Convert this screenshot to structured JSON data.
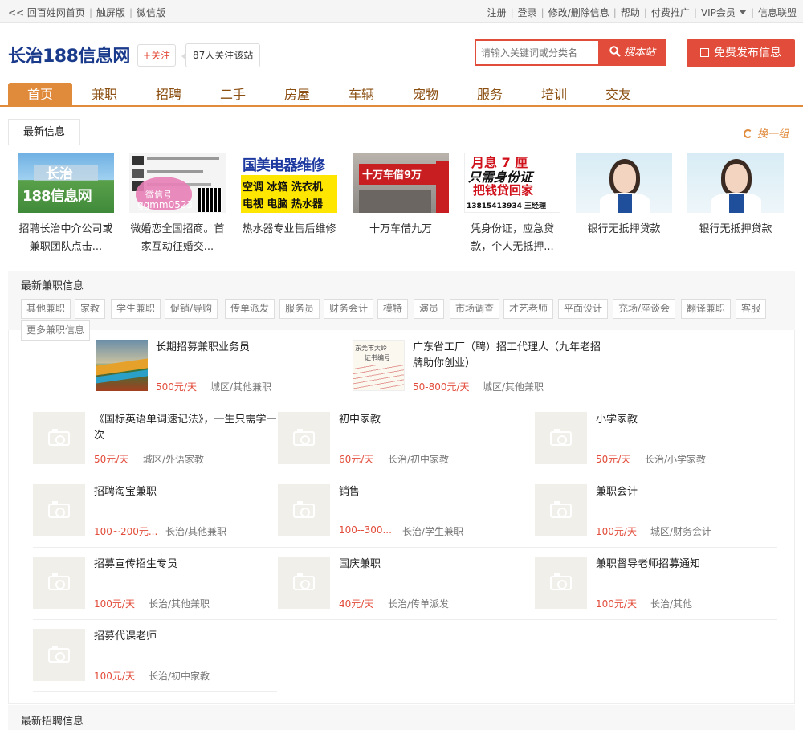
{
  "topbar": {
    "back_home": "<< 回百姓网首页",
    "touch": "触屏版",
    "wechat": "微信版",
    "register": "注册",
    "login": "登录",
    "edit_delete": "修改/删除信息",
    "help": "帮助",
    "paid_promo": "付费推广",
    "vip": "VIP会员",
    "alliance": "信息联盟"
  },
  "header": {
    "logo": "长治188信息网",
    "follow": "+关注",
    "follow_count": "87人关注该站",
    "search_placeholder": "请输入关键词或分类名",
    "search_button": "搜本站",
    "publish_button": "免费发布信息"
  },
  "nav": [
    "首页",
    "兼职",
    "招聘",
    "二手",
    "房屋",
    "车辆",
    "宠物",
    "服务",
    "培训",
    "交友"
  ],
  "latest": {
    "tab": "最新信息",
    "refresh": "换一组",
    "cards": [
      {
        "caption": "招聘长治中介公司或兼职团队点击...",
        "img_text1": "长治",
        "img_text2": "188信息网"
      },
      {
        "caption": "微婚恋全国招商。首家互动征婚交...",
        "img_text1": "微信号",
        "img_text2": "ggmm0523"
      },
      {
        "caption": "热水器专业售后维修",
        "img_text1": "国美电器维修",
        "img_text2": "空调 冰箱 洗衣机",
        "img_text3": "电视 电脑 热水器"
      },
      {
        "caption": "十万车借九万",
        "img_text1": "十万车借9万"
      },
      {
        "caption": "凭身份证，应急贷款，个人无抵押...",
        "img_text1": "月息 7 厘",
        "img_text2": "只需身份证",
        "img_text3": "把钱贷回家",
        "img_text4": "13815413934 王经理"
      },
      {
        "caption": "银行无抵押贷款"
      },
      {
        "caption": "银行无抵押贷款"
      }
    ]
  },
  "parttime": {
    "title": "最新兼职信息",
    "tags": [
      "其他兼职",
      "家教",
      "学生兼职",
      "促销/导购",
      "传单派发",
      "服务员",
      "财务会计",
      "模特",
      "演员",
      "市场调查",
      "才艺老师",
      "平面设计",
      "充场/座谈会",
      "翻译兼职",
      "客服",
      "更多兼职信息"
    ],
    "featured": [
      {
        "title": "长期招募兼职业务员",
        "price": "500元/天",
        "location": "城区/其他兼职"
      },
      {
        "title": "广东省工厂（聘）招工代理人（九年老招牌助你创业）",
        "price": "50-800元/天",
        "location": "城区/其他兼职",
        "img_text1": "东莞市大岭",
        "img_text2": "证书编号"
      }
    ],
    "listings": [
      {
        "title": "《国标英语单词速记法》，一生只需学一次",
        "price": "50元/天",
        "location": "城区/外语家教"
      },
      {
        "title": "初中家教",
        "price": "60元/天",
        "location": "长治/初中家教"
      },
      {
        "title": "小学家教",
        "price": "50元/天",
        "location": "长治/小学家教"
      },
      {
        "title": "招聘淘宝兼职",
        "price": "100~200元...",
        "location": "长治/其他兼职"
      },
      {
        "title": "销售",
        "price": "100--300...",
        "location": "长治/学生兼职"
      },
      {
        "title": "兼职会计",
        "price": "100元/天",
        "location": "城区/财务会计"
      },
      {
        "title": "招募宣传招生专员",
        "price": "100元/天",
        "location": "长治/其他兼职"
      },
      {
        "title": "国庆兼职",
        "price": "40元/天",
        "location": "长治/传单派发"
      },
      {
        "title": "兼职督导老师招募通知",
        "price": "100元/天",
        "location": "长治/其他"
      },
      {
        "title": "招募代课老师",
        "price": "100元/天",
        "location": "长治/初中家教"
      }
    ]
  },
  "recruit": {
    "title": "最新招聘信息"
  },
  "colors": {
    "accent": "#e24c3a",
    "nav": "#e08a3c",
    "logo": "#1a3a8c"
  }
}
